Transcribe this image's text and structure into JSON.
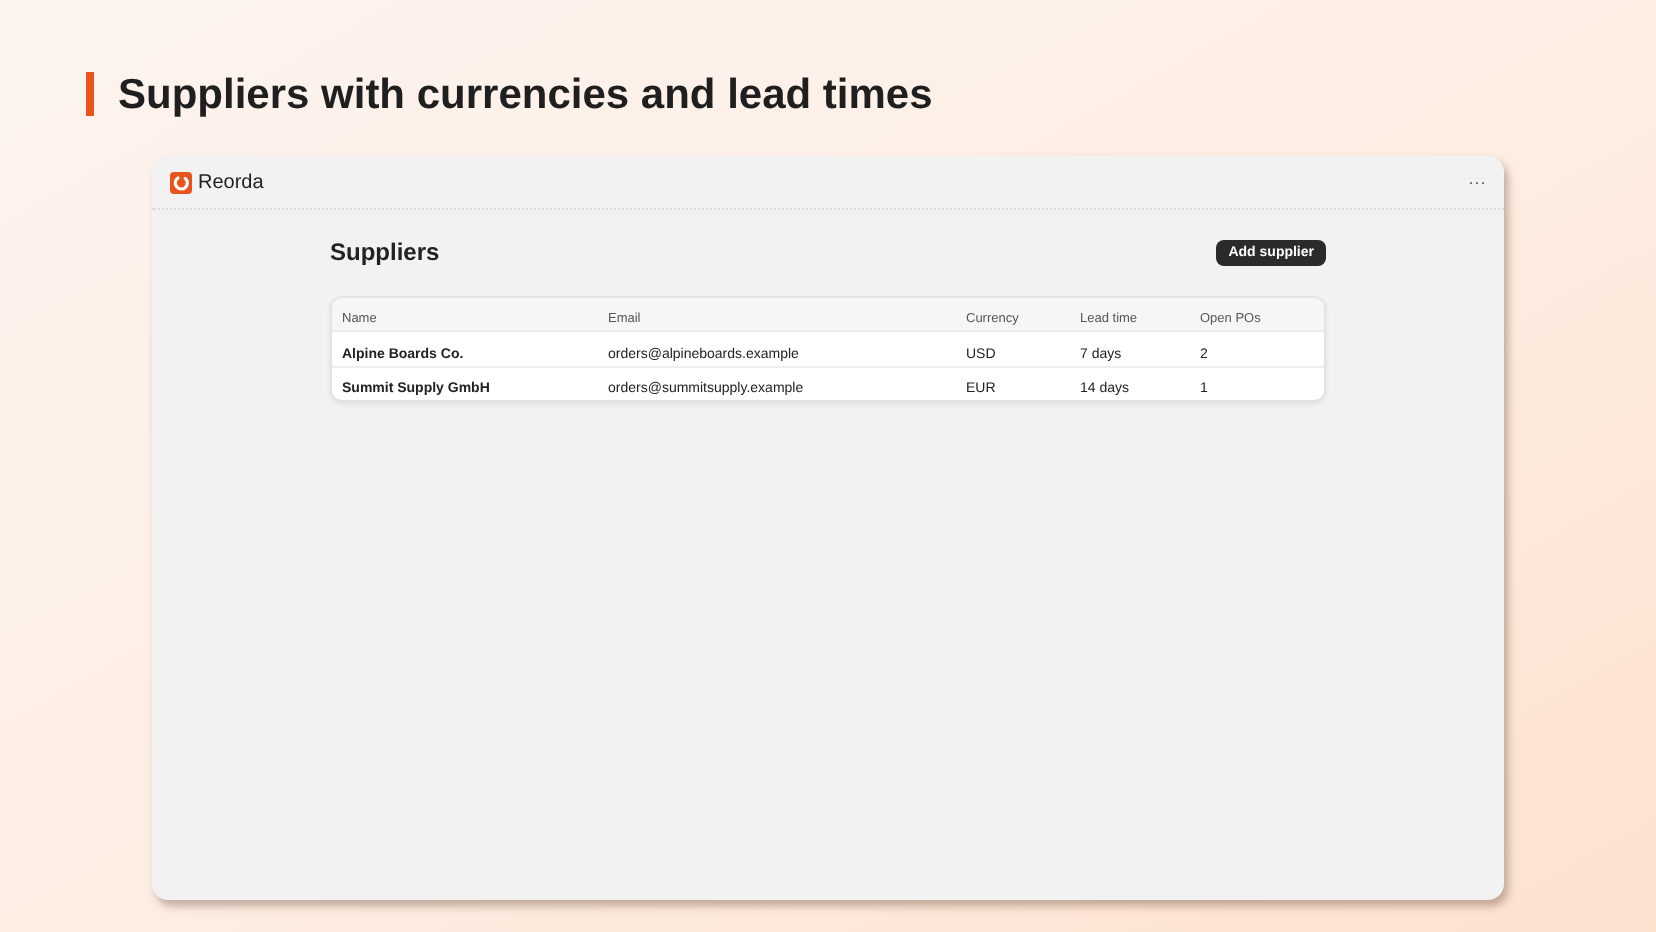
{
  "heading": "Suppliers with currencies and lead times",
  "app": {
    "name": "Reorda",
    "menu": "···"
  },
  "page": {
    "title": "Suppliers",
    "action": "Add supplier"
  },
  "table": {
    "columns": [
      "Name",
      "Email",
      "Currency",
      "Lead time",
      "Open POs"
    ],
    "rows": [
      [
        "Alpine Boards Co.",
        "orders@alpineboards.example",
        "USD",
        "7 days",
        "2"
      ],
      [
        "Summit Supply GmbH",
        "orders@summitsupply.example",
        "EUR",
        "14 days",
        "1"
      ]
    ]
  }
}
